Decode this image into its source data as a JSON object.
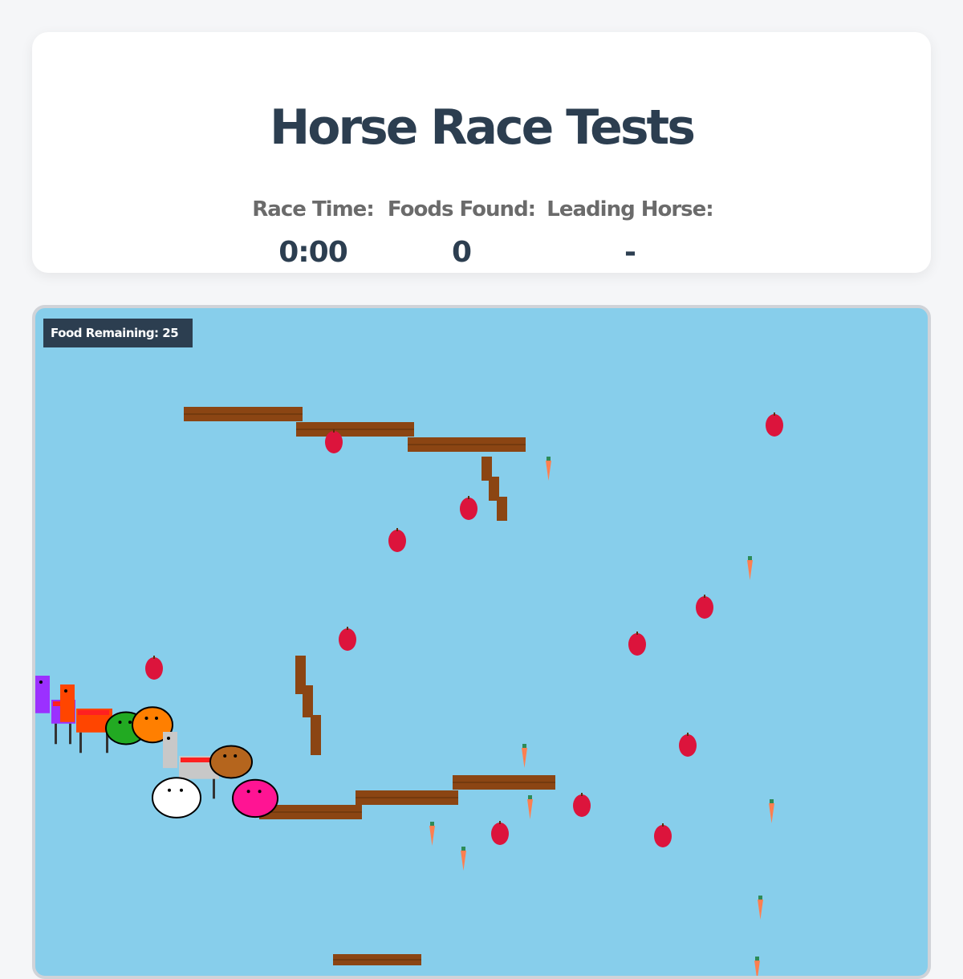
{
  "header": {
    "title": "Horse Race Tests",
    "stats": [
      {
        "label": "Race Time:",
        "value": "0:00"
      },
      {
        "label": "Foods Found:",
        "value": "0"
      },
      {
        "label": "Leading Horse:",
        "value": "-"
      }
    ]
  },
  "game": {
    "food_remaining_label": "Food Remaining: 25",
    "colors": {
      "sky": "#87ceeb",
      "platform": "#8b4513",
      "apple": "#dc143c",
      "carrot": "#ff7f50",
      "carrot_top": "#2e8b57",
      "hud": "#2c3e50"
    },
    "horses": [
      {
        "name": "purple-horse",
        "color": "#9b30ff"
      },
      {
        "name": "orange-horse",
        "color": "#ff4500"
      },
      {
        "name": "green-horse",
        "color": "#22aa22"
      },
      {
        "name": "orange-blob-horse",
        "color": "#ff7f00"
      },
      {
        "name": "gray-horse",
        "color": "#c8c8c8"
      },
      {
        "name": "brown-horse",
        "color": "#b5651d"
      },
      {
        "name": "white-horse",
        "color": "#ffffff"
      },
      {
        "name": "pink-horse",
        "color": "#ff1493"
      }
    ]
  }
}
